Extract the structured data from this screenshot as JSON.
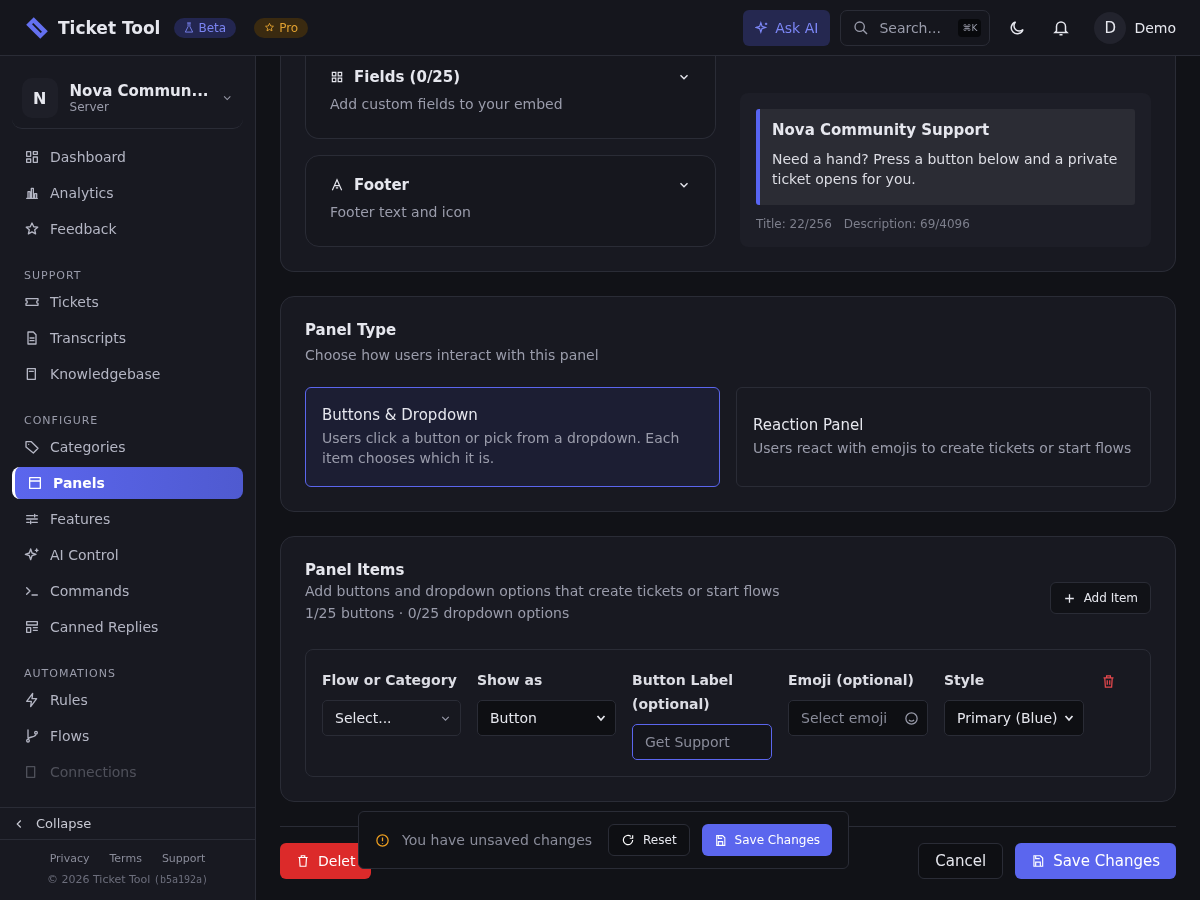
{
  "header": {
    "brand": "Ticket Tool",
    "badges": [
      {
        "label": "Beta",
        "kind": "beta"
      },
      {
        "label": "Pro",
        "kind": "pro"
      }
    ],
    "ask_ai": "Ask AI",
    "search": {
      "placeholder": "Search...",
      "shortcut": "⌘K"
    },
    "user": {
      "initial": "D",
      "name": "Demo"
    }
  },
  "sidebar": {
    "server": {
      "initial": "N",
      "name": "Nova Commun...",
      "subtitle": "Server"
    },
    "sections": [
      {
        "items": [
          {
            "label": "Dashboard",
            "selected": false
          },
          {
            "label": "Analytics",
            "selected": false
          },
          {
            "label": "Feedback",
            "selected": false
          }
        ]
      },
      {
        "heading": "SUPPORT",
        "items": [
          {
            "label": "Tickets",
            "selected": false
          },
          {
            "label": "Transcripts",
            "selected": false
          },
          {
            "label": "Knowledgebase",
            "selected": false
          }
        ]
      },
      {
        "heading": "CONFIGURE",
        "items": [
          {
            "label": "Categories",
            "selected": false
          },
          {
            "label": "Panels",
            "selected": true
          },
          {
            "label": "Features",
            "selected": false
          },
          {
            "label": "AI Control",
            "selected": false
          },
          {
            "label": "Commands",
            "selected": false
          },
          {
            "label": "Canned Replies",
            "selected": false
          }
        ]
      },
      {
        "heading": "AUTOMATIONS",
        "items": [
          {
            "label": "Rules",
            "selected": false
          },
          {
            "label": "Flows",
            "selected": false
          },
          {
            "label": "Connections",
            "selected": false
          }
        ]
      }
    ],
    "collapse": "Collapse",
    "links": [
      "Privacy",
      "Terms",
      "Support"
    ],
    "copyright": "© 2026 Ticket Tool",
    "build": "(b5a192a)"
  },
  "embed": {
    "sections": [
      {
        "title": "Fields (0/25)",
        "description": "Add custom fields to your embed",
        "expanded": false
      },
      {
        "title": "Footer",
        "description": "Footer text and icon",
        "expanded": false
      }
    ],
    "preview": {
      "title": "Nova Community Support",
      "description": "Need a hand? Press a button below and a private ticket opens for you.",
      "color": "#5865f2",
      "counts": [
        "Title: 22/256",
        "Description: 69/4096"
      ]
    }
  },
  "panel_type": {
    "title": "Panel Type",
    "description": "Choose how users interact with this panel",
    "options": [
      {
        "title": "Buttons & Dropdown",
        "description": "Users click a button or pick from a dropdown. Each item chooses which it is.",
        "selected": true
      },
      {
        "title": "Reaction Panel",
        "description": "Users react with emojis to create tickets or start flows",
        "selected": false
      }
    ]
  },
  "panel_items": {
    "title": "Panel Items",
    "description": "Add buttons and dropdown options that create tickets or start flows",
    "count": "1/25 buttons · 0/25 dropdown options",
    "add_button": "Add Item",
    "fields": [
      {
        "label": "Flow or Category",
        "kind": "combo",
        "value": "Select..."
      },
      {
        "label": "Show as",
        "kind": "select",
        "value": "Button"
      },
      {
        "label": "Button Label (optional)",
        "kind": "text",
        "placeholder": "Get Support",
        "focused": true
      },
      {
        "label": "Emoji (optional)",
        "kind": "emoji",
        "placeholder": "Select emoji"
      },
      {
        "label": "Style",
        "kind": "select",
        "value": "Primary (Blue)"
      }
    ]
  },
  "footer": {
    "delete": "Delet",
    "cancel": "Cancel",
    "save": "Save Changes"
  },
  "unsaved_bar": {
    "message": "You have unsaved changes",
    "reset": "Reset",
    "save": "Save Changes"
  }
}
